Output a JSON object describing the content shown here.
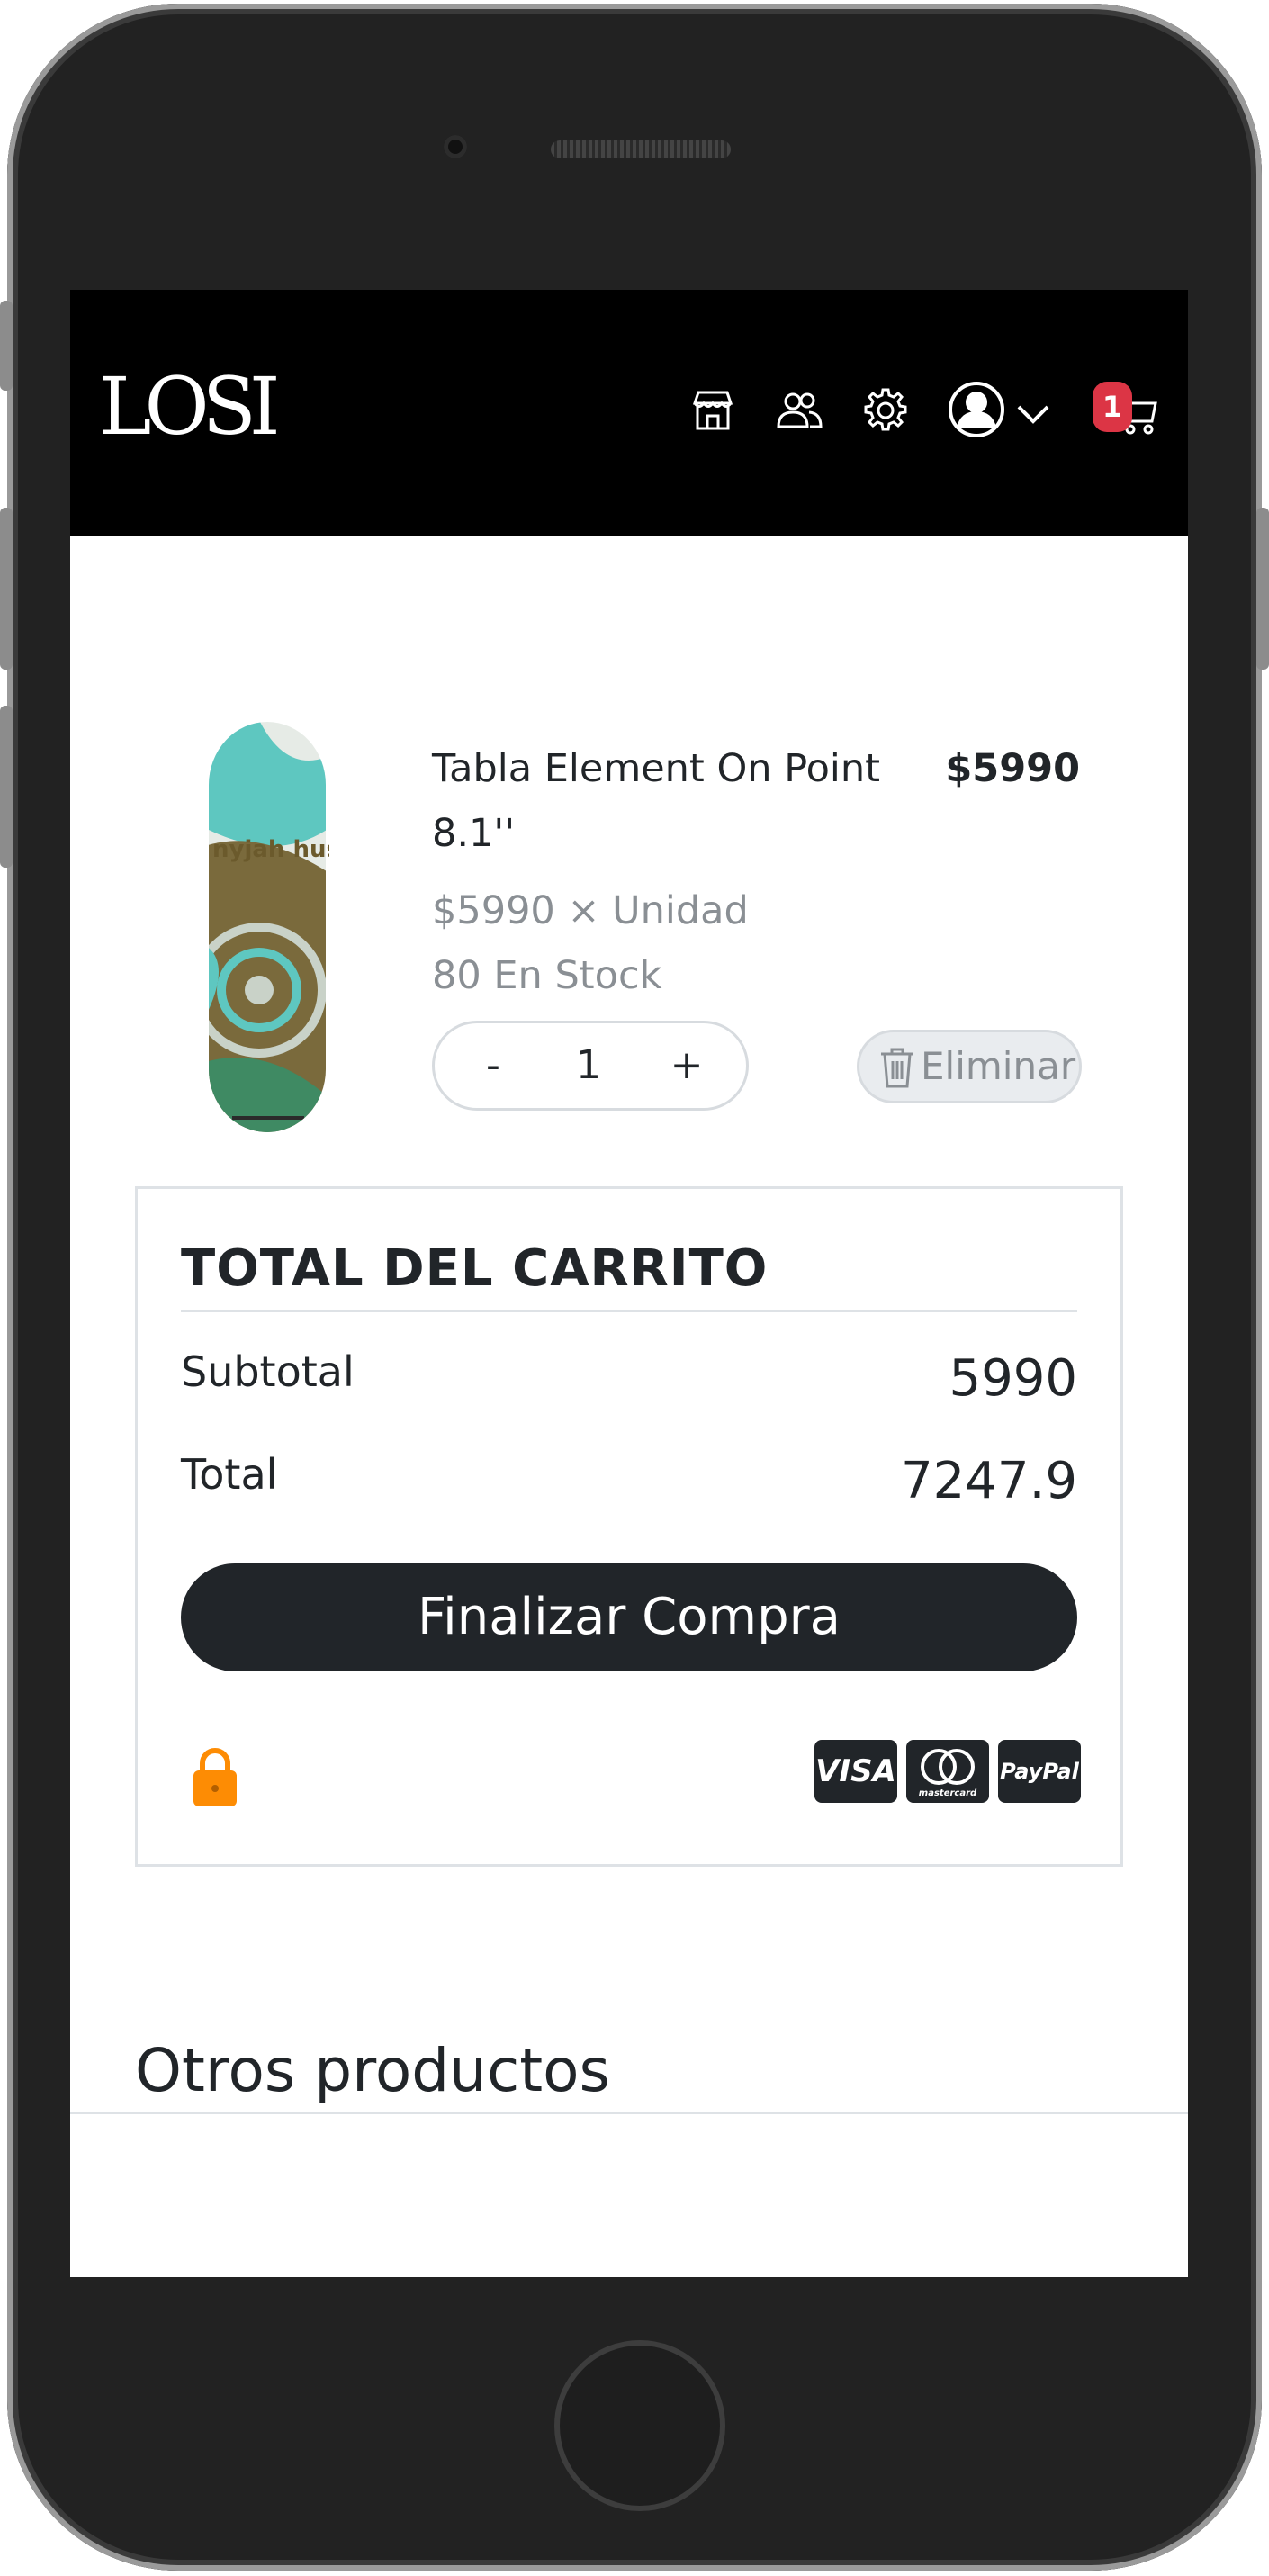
{
  "brand": {
    "logo_text": "LOSI"
  },
  "nav": {
    "icons": [
      "store-icon",
      "users-icon",
      "gear-icon",
      "user-circle-icon",
      "chevron-down-icon",
      "cart-icon"
    ],
    "cart_count": "1",
    "badge_color": "#dc3545"
  },
  "cart_item": {
    "name": "Tabla Element On Point 8.1''",
    "price": "$5990",
    "unit_price": "$5990 × Unidad",
    "stock": "80 En Stock",
    "quantity": "1",
    "minus_label": "-",
    "plus_label": "+",
    "remove_label": "Eliminar",
    "image_text": "nyjah huston"
  },
  "totals": {
    "title": "TOTAL DEL CARRITO",
    "subtotal_label": "Subtotal",
    "subtotal_value": "5990",
    "total_label": "Total",
    "total_value": "7247.9",
    "checkout_label": "Finalizar Compra",
    "lock_color": "#fd8c04",
    "payment_methods": [
      "VISA",
      "mastercard",
      "PayPal"
    ]
  },
  "other_products": {
    "title": "Otros productos"
  }
}
